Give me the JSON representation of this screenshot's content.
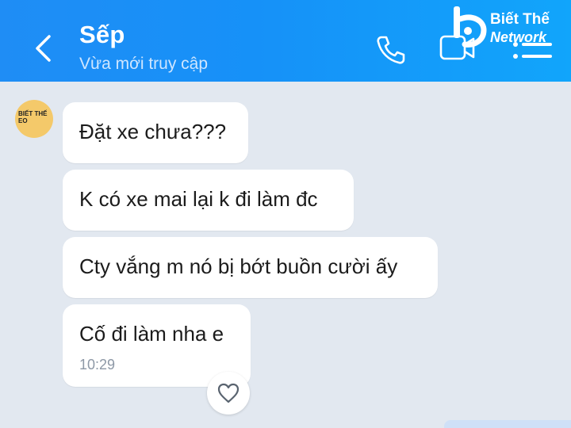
{
  "header": {
    "contact_name": "Sếp",
    "status": "Vừa mới truy cập",
    "icons": [
      "back-chevron-icon",
      "phone-icon",
      "video-call-icon",
      "menu-icon"
    ]
  },
  "watermark": {
    "line1": "Biết Thế",
    "line2": "Network"
  },
  "avatar": {
    "text": "BIẾT THẾ EO"
  },
  "messages": [
    {
      "text": "Đặt xe chưa???"
    },
    {
      "text": "K có xe mai lại k đi làm đc"
    },
    {
      "text": "Cty vắng m nó bị bớt buồn cười ấy"
    },
    {
      "text": "Cố đi làm nha e",
      "time": "10:29"
    }
  ],
  "reaction": {
    "icon": "heart-icon"
  },
  "colors": {
    "header_start": "#1f8df5",
    "header_end": "#11a5fb",
    "background": "#e2e8f0",
    "bubble": "#ffffff"
  }
}
